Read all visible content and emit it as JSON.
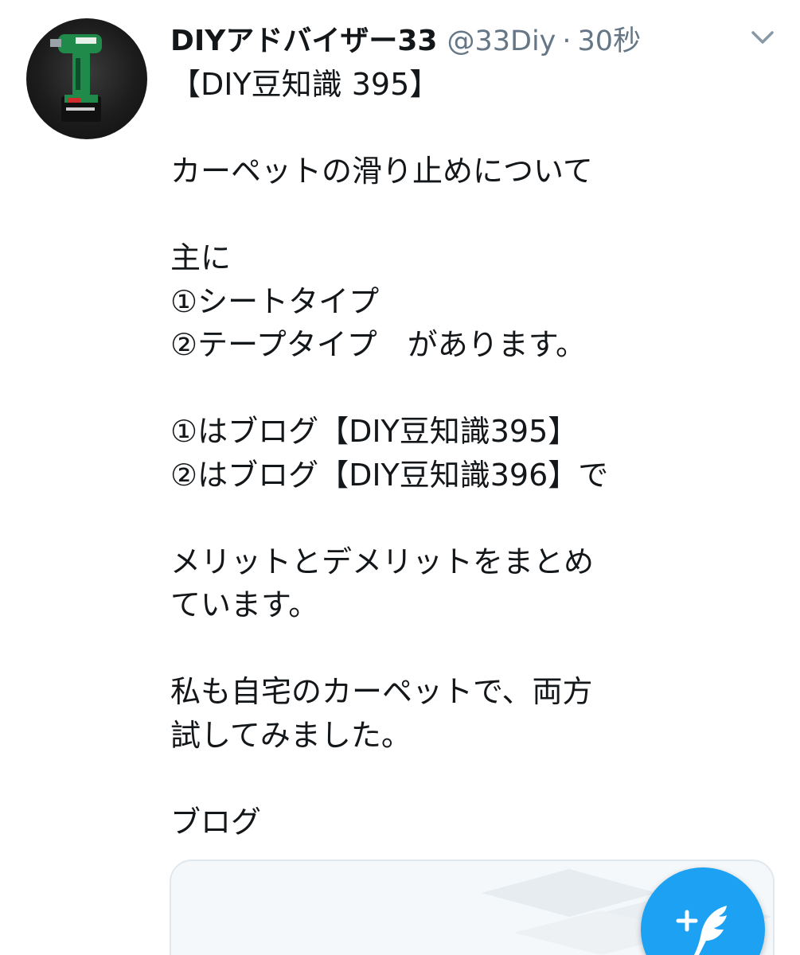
{
  "tweet": {
    "display_name": "DIYアドバイザー33",
    "handle": "@33Diy",
    "separator": "·",
    "time": "30秒",
    "lines": [
      "【DIY豆知識 395】",
      "",
      "カーペットの滑り止めについて",
      "",
      "主に",
      "①シートタイプ",
      "②テープタイプ　があります。",
      "",
      "①はブログ【DIY豆知識395】",
      "②はブログ【DIY豆知識396】で",
      "",
      "メリットとデメリットをまとめ",
      "ています。",
      "",
      "私も自宅のカーペットで、両方",
      "試してみました。",
      "",
      "ブログ"
    ]
  },
  "icons": {
    "menu": "chevron-down-icon",
    "compose": "compose-feather-icon",
    "avatar": "drill-avatar"
  },
  "colors": {
    "accent": "#1da1f2",
    "text": "#14171a",
    "secondary_text": "#657786",
    "card_border": "#e1e8ed"
  }
}
